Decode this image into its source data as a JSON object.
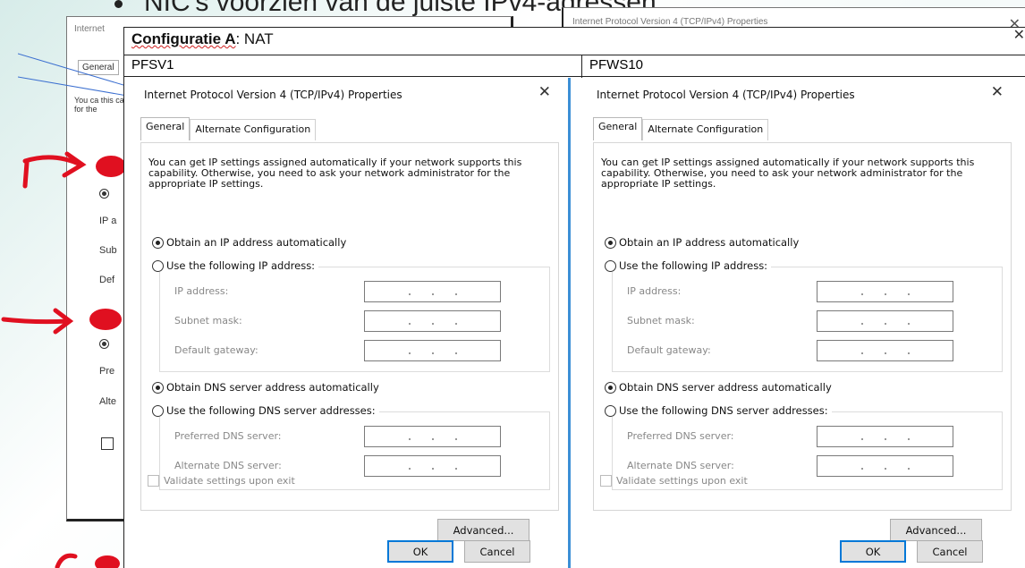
{
  "slide": {
    "bullet_text": "NIC's voorzien van de juiste IPv4-adressen",
    "bg_left_dialog": {
      "title": "Internet",
      "tab": "General",
      "desc_fragment": "You ca this ca for the",
      "frags": [
        "IP a",
        "Sub",
        "Def",
        "Pre",
        "Alte"
      ]
    },
    "bg_right_dialog": {
      "title": "Internet Protocol Version 4 (TCP/IPv4) Properties",
      "close": "✕"
    }
  },
  "overlay": {
    "header_bold": "Configuratie A",
    "header_rest": ": NAT",
    "close": "✕",
    "col_left_label": "PFSV1",
    "col_right_label": "PFWS10"
  },
  "dialogs": [
    {
      "title": "Internet Protocol Version 4 (TCP/IPv4) Properties",
      "close": "✕",
      "tabs": [
        "General",
        "Alternate Configuration"
      ],
      "description": "You can get IP settings assigned automatically if your network supports this capability. Otherwise, you need to ask your network administrator for the appropriate IP settings.",
      "obtain_ip_auto": "Obtain an IP address automatically",
      "use_following_ip": "Use the following IP address:",
      "ip_address_label": "IP address:",
      "subnet_mask_label": "Subnet mask:",
      "default_gateway_label": "Default gateway:",
      "obtain_dns_auto": "Obtain DNS server address automatically",
      "use_following_dns": "Use the following DNS server addresses:",
      "preferred_dns_label": "Preferred DNS server:",
      "alternate_dns_label": "Alternate DNS server:",
      "validate_label": "Validate settings upon exit",
      "advanced_button": "Advanced...",
      "ok_button": "OK",
      "cancel_button": "Cancel"
    },
    {
      "title": "Internet Protocol Version 4 (TCP/IPv4) Properties",
      "close": "✕",
      "tabs": [
        "General",
        "Alternate Configuration"
      ],
      "description": "You can get IP settings assigned automatically if your network supports this capability. Otherwise, you need to ask your network administrator for the appropriate IP settings.",
      "obtain_ip_auto": "Obtain an IP address automatically",
      "use_following_ip": "Use the following IP address:",
      "ip_address_label": "IP address:",
      "subnet_mask_label": "Subnet mask:",
      "default_gateway_label": "Default gateway:",
      "obtain_dns_auto": "Obtain DNS server address automatically",
      "use_following_dns": "Use the following DNS server addresses:",
      "preferred_dns_label": "Preferred DNS server:",
      "alternate_dns_label": "Alternate DNS server:",
      "validate_label": "Validate settings upon exit",
      "advanced_button": "Advanced...",
      "ok_button": "OK",
      "cancel_button": "Cancel"
    }
  ],
  "colors": {
    "annotation_red": "#e01020",
    "focus_blue": "#0078d7"
  }
}
